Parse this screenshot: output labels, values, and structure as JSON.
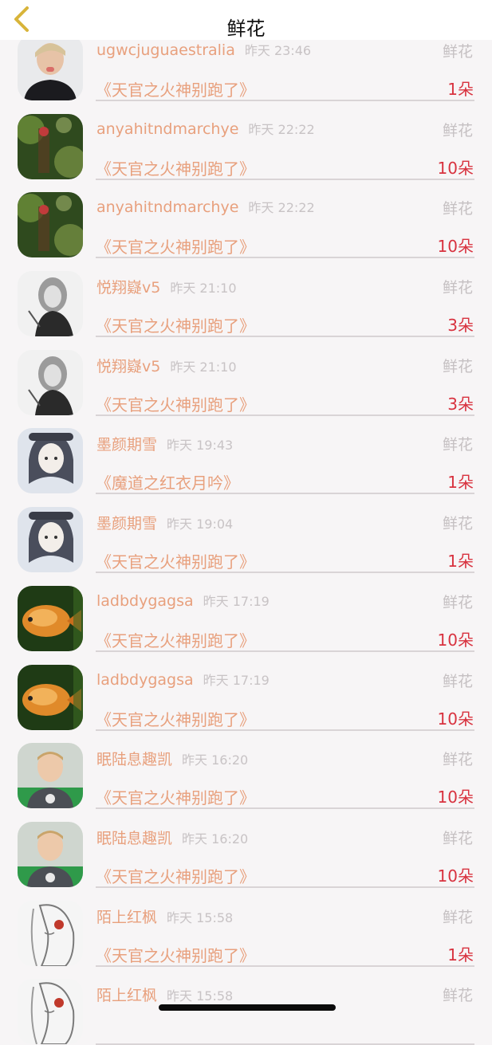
{
  "header": {
    "title": "鲜花",
    "back_icon": "chevron-left-icon"
  },
  "colors": {
    "accent": "#e8a07d",
    "count": "#d8323f",
    "muted": "#c5c0c2",
    "back": "#d8b43a"
  },
  "rows": [
    {
      "name": "ugwcjuguaestralia",
      "time": "昨天 23:46",
      "gift": "鲜花",
      "book": "《天官之火神别跑了》",
      "count": "1朵",
      "avatar": "blond-man-photo"
    },
    {
      "name": "anyahitndmarchye",
      "time": "昨天 22:22",
      "gift": "鲜花",
      "book": "《天官之火神别跑了》",
      "count": "10朵",
      "avatar": "green-bokeh-photo"
    },
    {
      "name": "anyahitndmarchye",
      "time": "昨天 22:22",
      "gift": "鲜花",
      "book": "《天官之火神别跑了》",
      "count": "10朵",
      "avatar": "green-bokeh-photo"
    },
    {
      "name": "悦翔嶷v5",
      "time": "昨天 21:10",
      "gift": "鲜花",
      "book": "《天官之火神别跑了》",
      "count": "3朵",
      "avatar": "sketch-girl-drawing"
    },
    {
      "name": "悦翔嶷v5",
      "time": "昨天 21:10",
      "gift": "鲜花",
      "book": "《天官之火神别跑了》",
      "count": "3朵",
      "avatar": "sketch-girl-drawing"
    },
    {
      "name": "墨颜期雪",
      "time": "昨天 19:43",
      "gift": "鲜花",
      "book": "《魔道之红衣月吟》",
      "count": "1朵",
      "avatar": "anime-girl-drawing"
    },
    {
      "name": "墨颜期雪",
      "time": "昨天 19:04",
      "gift": "鲜花",
      "book": "《天官之火神别跑了》",
      "count": "1朵",
      "avatar": "anime-girl-drawing"
    },
    {
      "name": "ladbdygagsa",
      "time": "昨天 17:19",
      "gift": "鲜花",
      "book": "《天官之火神别跑了》",
      "count": "10朵",
      "avatar": "orange-fish-photo"
    },
    {
      "name": "ladbdygagsa",
      "time": "昨天 17:19",
      "gift": "鲜花",
      "book": "《天官之火神别跑了》",
      "count": "10朵",
      "avatar": "orange-fish-photo"
    },
    {
      "name": "眠陆息趣凯",
      "time": "昨天 16:20",
      "gift": "鲜花",
      "book": "《天官之火神别跑了》",
      "count": "10朵",
      "avatar": "boy-photo"
    },
    {
      "name": "眠陆息趣凯",
      "time": "昨天 16:20",
      "gift": "鲜花",
      "book": "《天官之火神别跑了》",
      "count": "10朵",
      "avatar": "boy-photo"
    },
    {
      "name": "陌上红枫",
      "time": "昨天 15:58",
      "gift": "鲜花",
      "book": "《天官之火神别跑了》",
      "count": "1朵",
      "avatar": "sketch-woman-drawing"
    },
    {
      "name": "陌上红枫",
      "time": "昨天 15:58",
      "gift": "鲜花",
      "book": "",
      "count": "",
      "avatar": "sketch-woman-drawing"
    }
  ]
}
